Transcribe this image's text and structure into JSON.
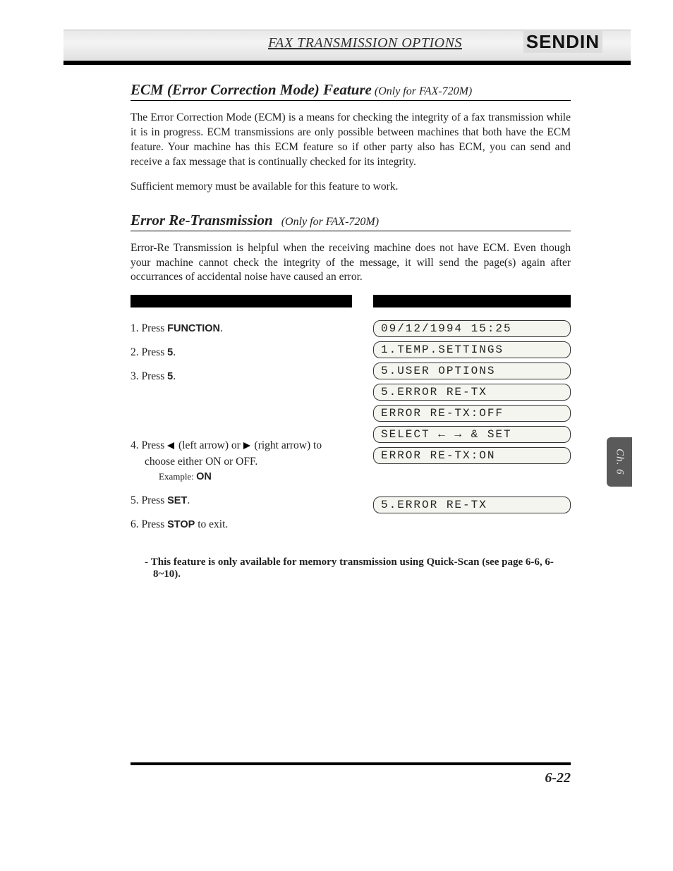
{
  "header": {
    "left_title": "FAX TRANSMISSION OPTIONS",
    "right_title": "SENDIN"
  },
  "section1": {
    "heading_main": "ECM (Error Correction Mode) Feature",
    "heading_sub": "(Only for FAX-720M)",
    "para1": "The Error Correction Mode (ECM) is a means for checking the integrity of a fax transmission while it is in progress. ECM transmissions are only possible between machines that both have the ECM feature. Your machine has this ECM feature so if other party also has ECM, you can send and receive a fax message that is continually checked for its integrity.",
    "para2": "Sufficient memory must be available for this feature to work."
  },
  "section2": {
    "heading_main": "Error Re-Transmission",
    "heading_sub": "(Only for FAX-720M)",
    "para1": "Error-Re Transmission is helpful when the receiving machine does not have ECM. Even though your machine cannot check the integrity of the message, it will send the page(s) again after occurrances of accidental noise have caused an error."
  },
  "steps": {
    "s1_pre": "1. Press ",
    "s1_b": "FUNCTION",
    "s1_post": ".",
    "s2_pre": "2. Press ",
    "s2_b": "5",
    "s2_post": ".",
    "s3_pre": "3. Press ",
    "s3_b": "5",
    "s3_post": ".",
    "s4_pre": "4. Press ",
    "s4_mid": " (left arrow) or ",
    "s4_post": " (right arrow) to choose either ON or OFF.",
    "s4_ex_pre": "Example: ",
    "s4_ex_b": "ON",
    "s5_pre": "5. Press ",
    "s5_b": "SET",
    "s5_post": ".",
    "s6_pre": "6. Press ",
    "s6_b": "STOP",
    "s6_post": " to exit."
  },
  "lcd": {
    "l1": "09/12/1994 15:25",
    "l2": "1.TEMP.SETTINGS",
    "l3": "5.USER OPTIONS",
    "l4": "5.ERROR RE-TX",
    "l5": "ERROR RE-TX:OFF",
    "l6": "SELECT ← → & SET",
    "l7": "ERROR RE-TX:ON",
    "l8": "5.ERROR RE-TX"
  },
  "note": {
    "text_pre": "- ",
    "text_bold": "This feature is only available for memory transmission using Quick-Scan (see page 6-6, 6-8~10)."
  },
  "tab": "Ch. 6",
  "page_number": "6-22"
}
